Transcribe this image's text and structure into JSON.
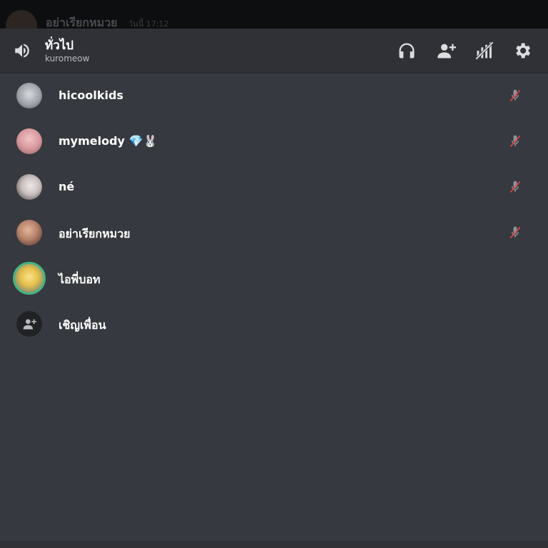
{
  "background_message": {
    "author": "อย่าเรียกหมวย",
    "time": "วันนี้ 17:12"
  },
  "header": {
    "channel_name": "ทั่วไป",
    "server_name": "kuromeow",
    "icons": [
      "speaker-icon",
      "headphones-icon",
      "add-user-icon",
      "voice-signal-off-icon",
      "settings-icon"
    ]
  },
  "members": [
    {
      "name": "hicoolkids",
      "muted": true,
      "avatar_color": "#9ea3aa"
    },
    {
      "name": "mymelody 💎🐰",
      "muted": true,
      "avatar_color": "#d89aa0"
    },
    {
      "name": "né",
      "muted": true,
      "avatar_color": "#c7c0bf"
    },
    {
      "name": "อย่าเรียกหมวย",
      "muted": true,
      "avatar_color": "#b5836a"
    },
    {
      "name": "ไอพี่บอท",
      "speaking": true,
      "avatar_color": "#e8c24a"
    }
  ],
  "invite": {
    "label": "เชิญเพื่อน"
  },
  "colors": {
    "background": "#36393f",
    "header": "#2f3136",
    "speaking_ring": "#43b581",
    "muted_icon": "#ed4245"
  }
}
